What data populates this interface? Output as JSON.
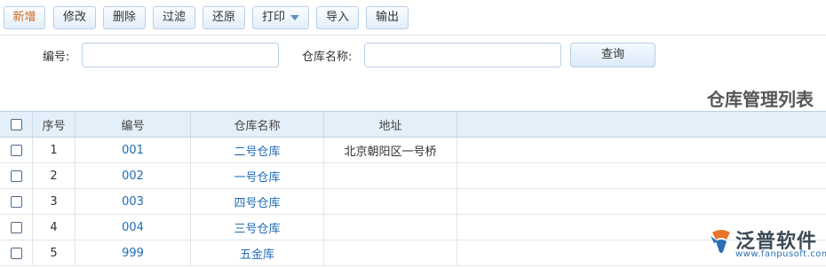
{
  "toolbar": {
    "buttons": [
      "新增",
      "修改",
      "删除",
      "过滤",
      "还原",
      "打印",
      "导入",
      "输出"
    ]
  },
  "query": {
    "code_label": "编号:",
    "code_value": "",
    "name_label": "仓库名称:",
    "name_value": "",
    "search_label": "查询"
  },
  "list_title": "仓库管理列表",
  "table": {
    "columns": [
      "序号",
      "编号",
      "仓库名称",
      "地址"
    ],
    "rows": [
      {
        "seq": "1",
        "code": "001",
        "name": "二号仓库",
        "address": "北京朝阳区一号桥"
      },
      {
        "seq": "2",
        "code": "002",
        "name": "一号仓库",
        "address": ""
      },
      {
        "seq": "3",
        "code": "003",
        "name": "四号仓库",
        "address": ""
      },
      {
        "seq": "4",
        "code": "004",
        "name": "三号仓库",
        "address": ""
      },
      {
        "seq": "5",
        "code": "999",
        "name": "五金库",
        "address": ""
      }
    ]
  },
  "logo": {
    "text": "泛普软件",
    "url": "www.fanpusoft.com",
    "icon": "fanpu-logo-icon"
  },
  "colors": {
    "accent": "#1f6db5",
    "header_bg": "#e3eff9",
    "primary_button_text": "#d2691e"
  }
}
